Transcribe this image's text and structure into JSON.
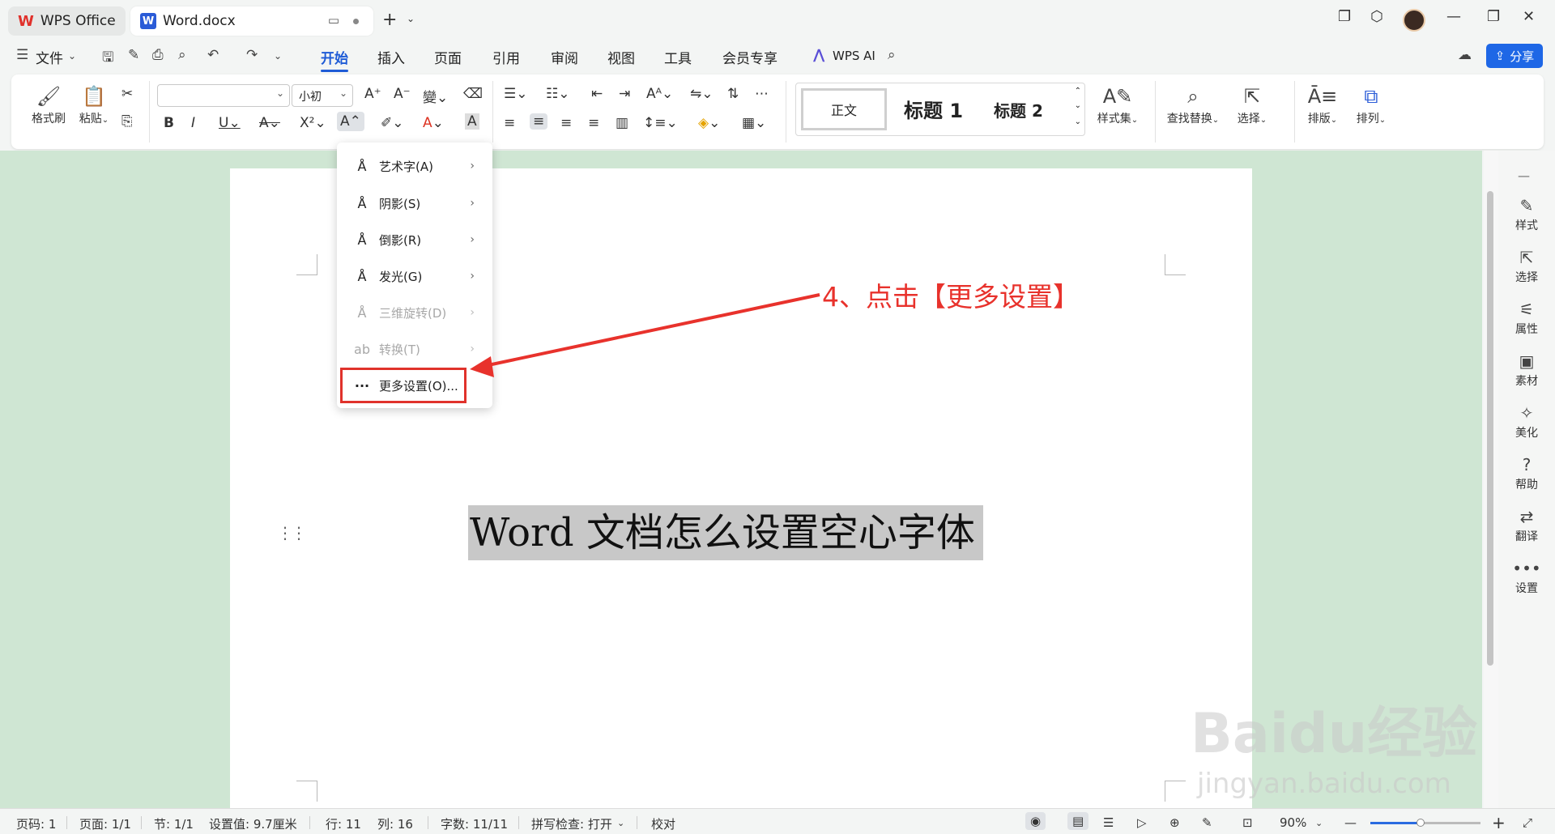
{
  "tabs": {
    "wps": "WPS Office",
    "doc": "Word.docx"
  },
  "menu": {
    "file": "文件",
    "items": [
      "开始",
      "插入",
      "页面",
      "引用",
      "审阅",
      "视图",
      "工具",
      "会员专享"
    ],
    "wps_ai": "WPS AI",
    "share": "分享"
  },
  "ribbon": {
    "format_painter": "格式刷",
    "paste": "粘贴",
    "font_size": "小初",
    "style_normal": "正文",
    "style_h1": "标题 1",
    "style_h2": "标题 2",
    "style_set": "样式集",
    "find_replace": "查找替换",
    "select": "选择",
    "layout": "排版",
    "arrange": "排列"
  },
  "dropdown": {
    "items": [
      {
        "label": "艺术字(A)",
        "disabled": false
      },
      {
        "label": "阴影(S)",
        "disabled": false
      },
      {
        "label": "倒影(R)",
        "disabled": false
      },
      {
        "label": "发光(G)",
        "disabled": false
      },
      {
        "label": "三维旋转(D)",
        "disabled": true
      },
      {
        "label": "转换(T)",
        "disabled": true
      }
    ],
    "more_settings": "更多设置(O)..."
  },
  "document": {
    "text": "Word 文档怎么设置空心字体"
  },
  "annotation": {
    "text": "4、点击【更多设置】",
    "color": "#e8322c"
  },
  "right_panel": [
    "样式",
    "选择",
    "属性",
    "素材",
    "美化",
    "帮助",
    "翻译",
    "设置"
  ],
  "status": {
    "page_num": "页码: 1",
    "pages": "页面: 1/1",
    "section": "节: 1/1",
    "setting": "设置值: 9.7厘米",
    "row": "行: 11",
    "col": "列: 16",
    "words": "字数: 11/11",
    "spell": "拼写检查: 打开",
    "proof": "校对",
    "zoom": "90%"
  },
  "watermark": {
    "main": "Baidu经验",
    "sub": "jingyan.baidu.com"
  }
}
